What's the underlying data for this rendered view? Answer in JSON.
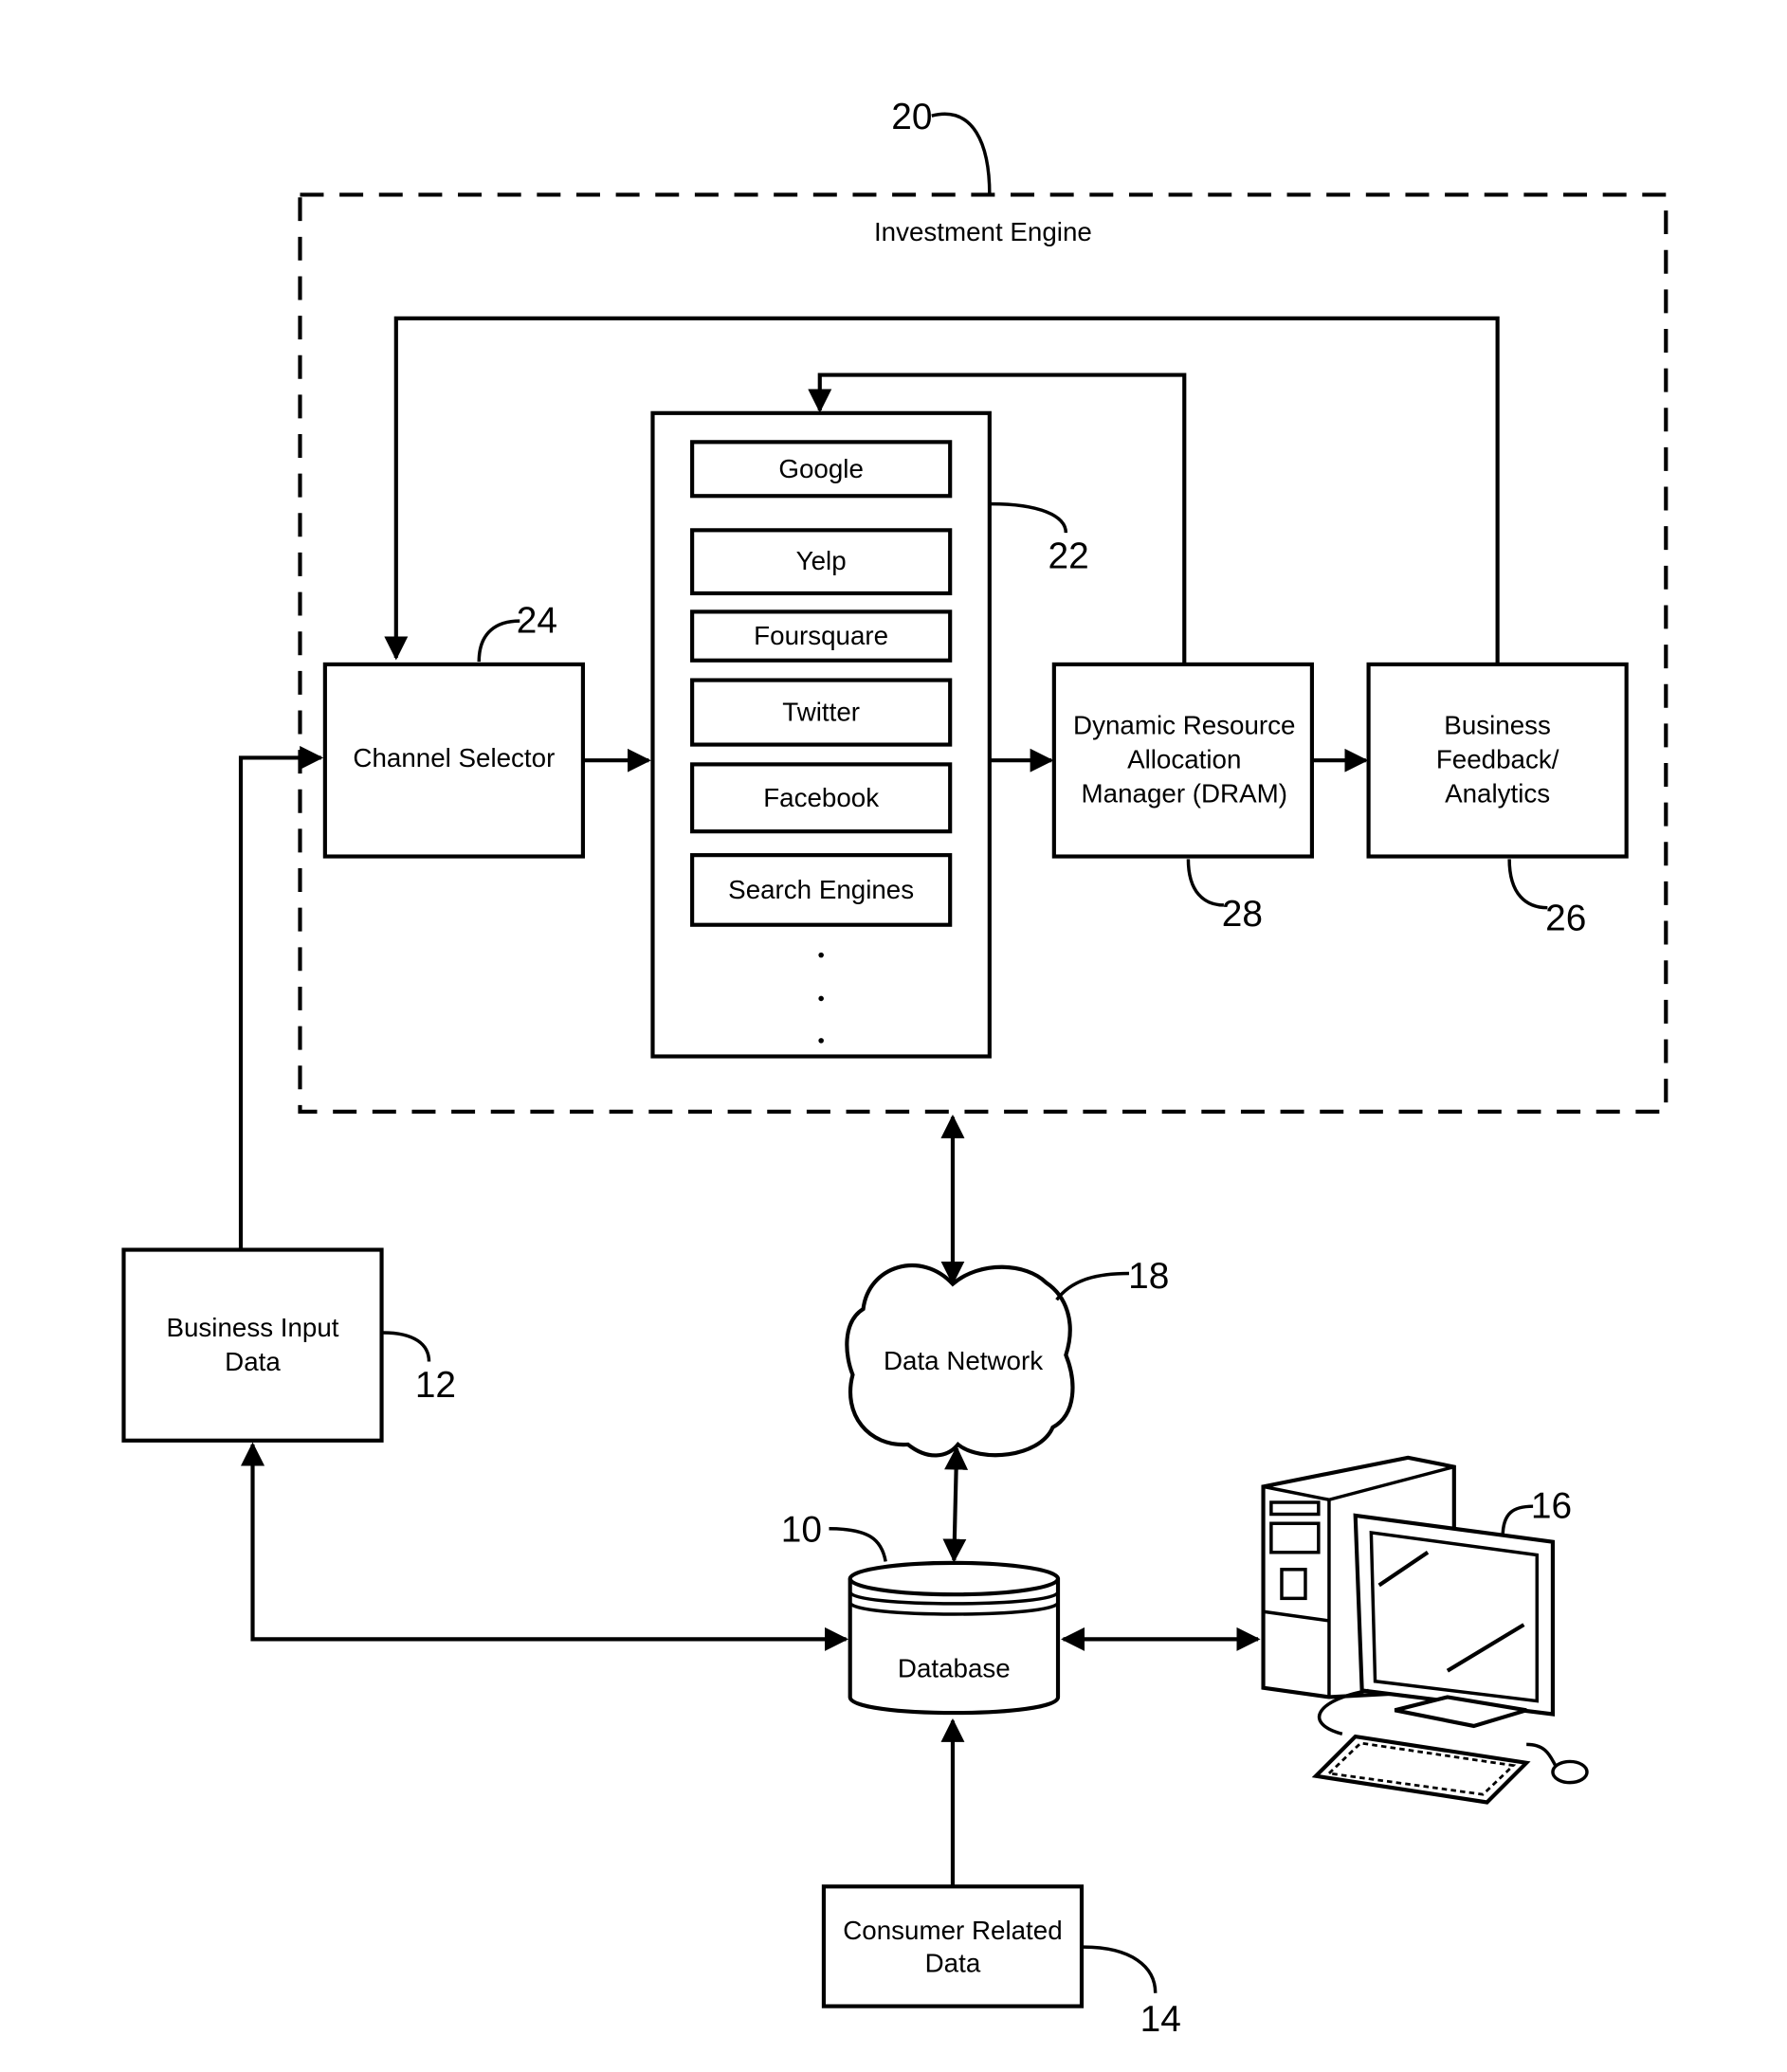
{
  "figure": {
    "container": {
      "title": "Investment Engine",
      "ref": "20"
    },
    "channel_selector": {
      "label": "Channel Selector",
      "ref": "24"
    },
    "channels": {
      "ref": "22",
      "items": [
        "Google",
        "Yelp",
        "Foursquare",
        "Twitter",
        "Facebook",
        "Search Engines"
      ],
      "ellipsis": "."
    },
    "dram": {
      "lines": [
        "Dynamic Resource",
        "Allocation",
        "Manager (DRAM)"
      ],
      "ref": "28"
    },
    "feedback": {
      "lines": [
        "Business",
        "Feedback/",
        "Analytics"
      ],
      "ref": "26"
    },
    "business_input": {
      "lines": [
        "Business Input",
        "Data"
      ],
      "ref": "12"
    },
    "network": {
      "label": "Data Network",
      "ref": "18"
    },
    "database": {
      "label": "Database",
      "ref": "10"
    },
    "computer": {
      "ref": "16"
    },
    "consumer": {
      "lines": [
        "Consumer Related",
        "Data"
      ],
      "ref": "14"
    }
  }
}
